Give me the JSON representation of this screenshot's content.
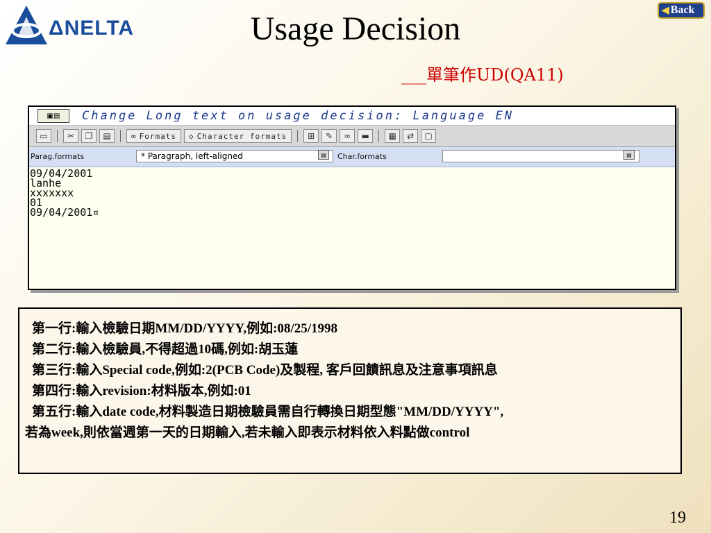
{
  "slide": {
    "logo_text": "ΔNELTA",
    "title": "Usage Decision",
    "subtitle": "___單筆作UD(QA11)",
    "back_label": "Back",
    "page_number": "19"
  },
  "sap_window": {
    "title": "Change Long text on usage decision: Language EN",
    "toolbar": {
      "formats_label": "Formats",
      "char_formats_label": "Character formats"
    },
    "format_bar": {
      "parag_label": "Parag.formats",
      "parag_value": "* Paragraph, left-aligned",
      "char_label": "Char.formats",
      "char_value": ""
    },
    "text_lines": [
      "09/04/2001",
      "lanhe",
      "xxxxxxx",
      "01",
      "09/04/2001¤"
    ]
  },
  "description": {
    "lines": [
      "第一行:輸入檢驗日期MM/DD/YYYY,例如:08/25/1998",
      "第二行:輸入檢驗員,不得超過10碼,例如:胡玉蓮",
      "第三行:輸入Special code,例如:2(PCB Code)及製程, 客戶回饋訊息及注意事項訊息",
      "第四行:輸入revision:材料版本,例如:01",
      "第五行:輸入date code,材料製造日期檢驗員需自行轉換日期型態\"MM/DD/YYYY\",",
      "若為week,則依當週第一天的日期輸入,若未輸入即表示材料依入料點做control"
    ]
  }
}
